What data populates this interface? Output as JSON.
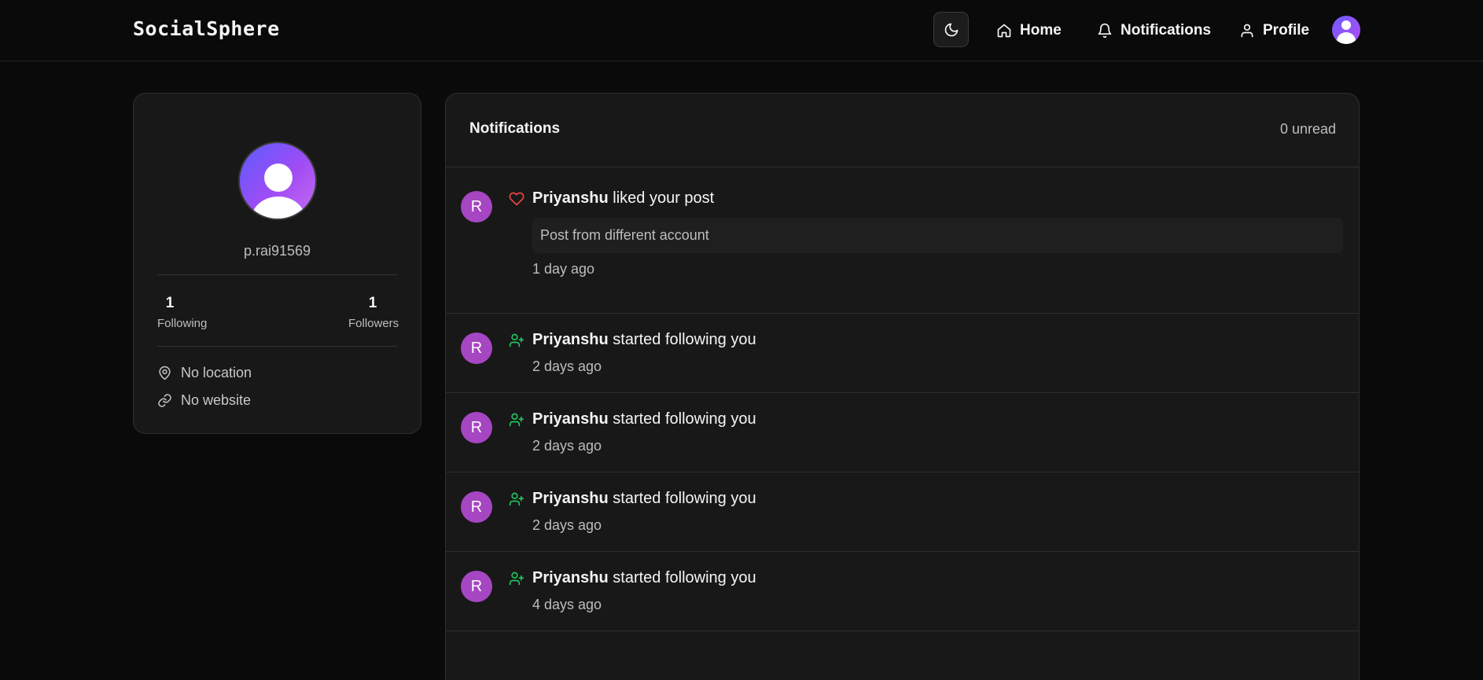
{
  "header": {
    "brand": "SocialSphere",
    "nav": [
      {
        "label": "Home",
        "icon": "home-icon"
      },
      {
        "label": "Notifications",
        "icon": "bell-icon"
      },
      {
        "label": "Profile",
        "icon": "user-icon"
      }
    ]
  },
  "profile": {
    "username": "p.rai91569",
    "following_count": "1",
    "following_label": "Following",
    "followers_count": "1",
    "followers_label": "Followers",
    "location": "No location",
    "website": "No website"
  },
  "notifications": {
    "title": "Notifications",
    "unread": "0 unread",
    "items": [
      {
        "avatar": "R",
        "type": "like",
        "actor": "Priyanshu",
        "action": " liked your post",
        "snippet": "Post from different account",
        "time": "1 day ago"
      },
      {
        "avatar": "R",
        "type": "follow",
        "actor": "Priyanshu",
        "action": " started following you",
        "time": "2 days ago"
      },
      {
        "avatar": "R",
        "type": "follow",
        "actor": "Priyanshu",
        "action": " started following you",
        "time": "2 days ago"
      },
      {
        "avatar": "R",
        "type": "follow",
        "actor": "Priyanshu",
        "action": " started following you",
        "time": "2 days ago"
      },
      {
        "avatar": "R",
        "type": "follow",
        "actor": "Priyanshu",
        "action": " started following you",
        "time": "4 days ago"
      }
    ]
  },
  "colors": {
    "accent_avatar": "#a646c2",
    "like_icon": "#ef4444",
    "follow_icon": "#22c55e",
    "background": "#0a0a0a",
    "card": "#181818"
  }
}
